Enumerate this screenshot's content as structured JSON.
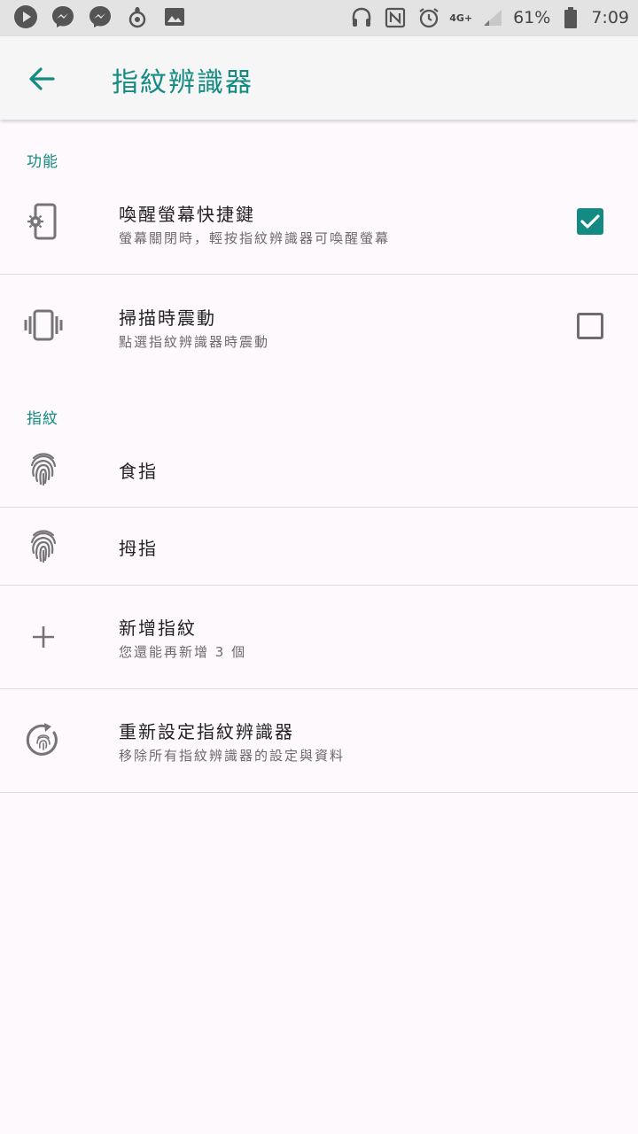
{
  "status_bar": {
    "battery_percent": "61%",
    "time": "7:09",
    "network": "4G+"
  },
  "app_bar": {
    "title": "指紋辨識器"
  },
  "sections": {
    "features_header": "功能",
    "fingerprints_header": "指紋"
  },
  "settings": {
    "wake_screen": {
      "title": "喚醒螢幕快捷鍵",
      "subtitle": "螢幕關閉時，輕按指紋辨識器可喚醒螢幕",
      "checked": true
    },
    "vibrate": {
      "title": "掃描時震動",
      "subtitle": "點選指紋辨識器時震動",
      "checked": false
    }
  },
  "fingerprints": [
    {
      "name": "食指"
    },
    {
      "name": "拇指"
    }
  ],
  "add_fingerprint": {
    "title": "新增指紋",
    "subtitle": "您還能再新增 3 個"
  },
  "reset": {
    "title": "重新設定指紋辨識器",
    "subtitle": "移除所有指紋辨識器的設定與資料"
  },
  "colors": {
    "accent": "#138a82",
    "status_bar": "#e3e3e3",
    "background": "#fdf9fd"
  }
}
